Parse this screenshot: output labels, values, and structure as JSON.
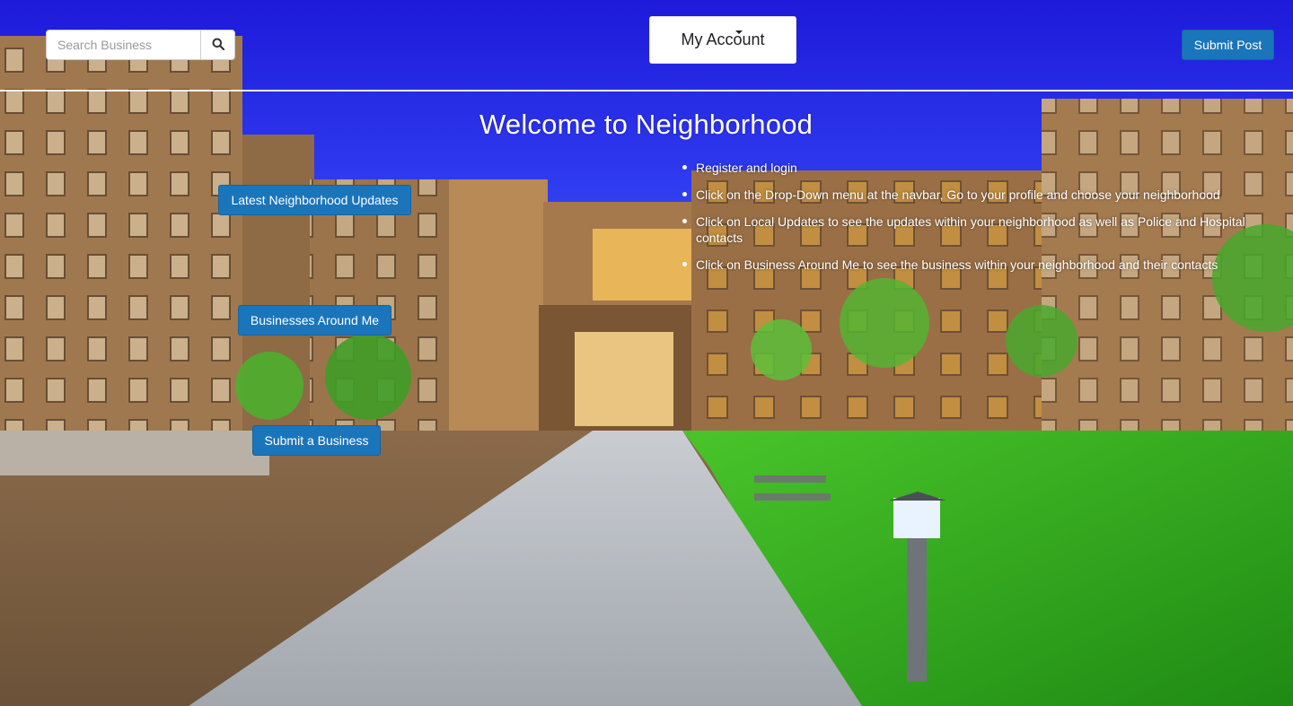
{
  "navbar": {
    "search_placeholder": "Search Business",
    "search_icon": "search-icon",
    "account_label": "My Account",
    "submit_post_label": "Submit Post"
  },
  "main": {
    "title": "Welcome to Neighborhood",
    "buttons": {
      "latest_updates": "Latest Neighborhood Updates",
      "businesses_around": "Businesses Around Me",
      "submit_business": "Submit a Business"
    },
    "instructions": [
      "Register and login",
      "Click on the Drop-Down menu at the navbar, Go to your profile and choose your neighborhood",
      "Click on Local Updates to see the updates within your neighborhood as well as Police and Hospital contacts",
      "Click on Business Around Me to see the business within your neighborhood and their contacts"
    ]
  },
  "colors": {
    "primary_button": "#1b75bb",
    "sky": "#2a28e0"
  }
}
